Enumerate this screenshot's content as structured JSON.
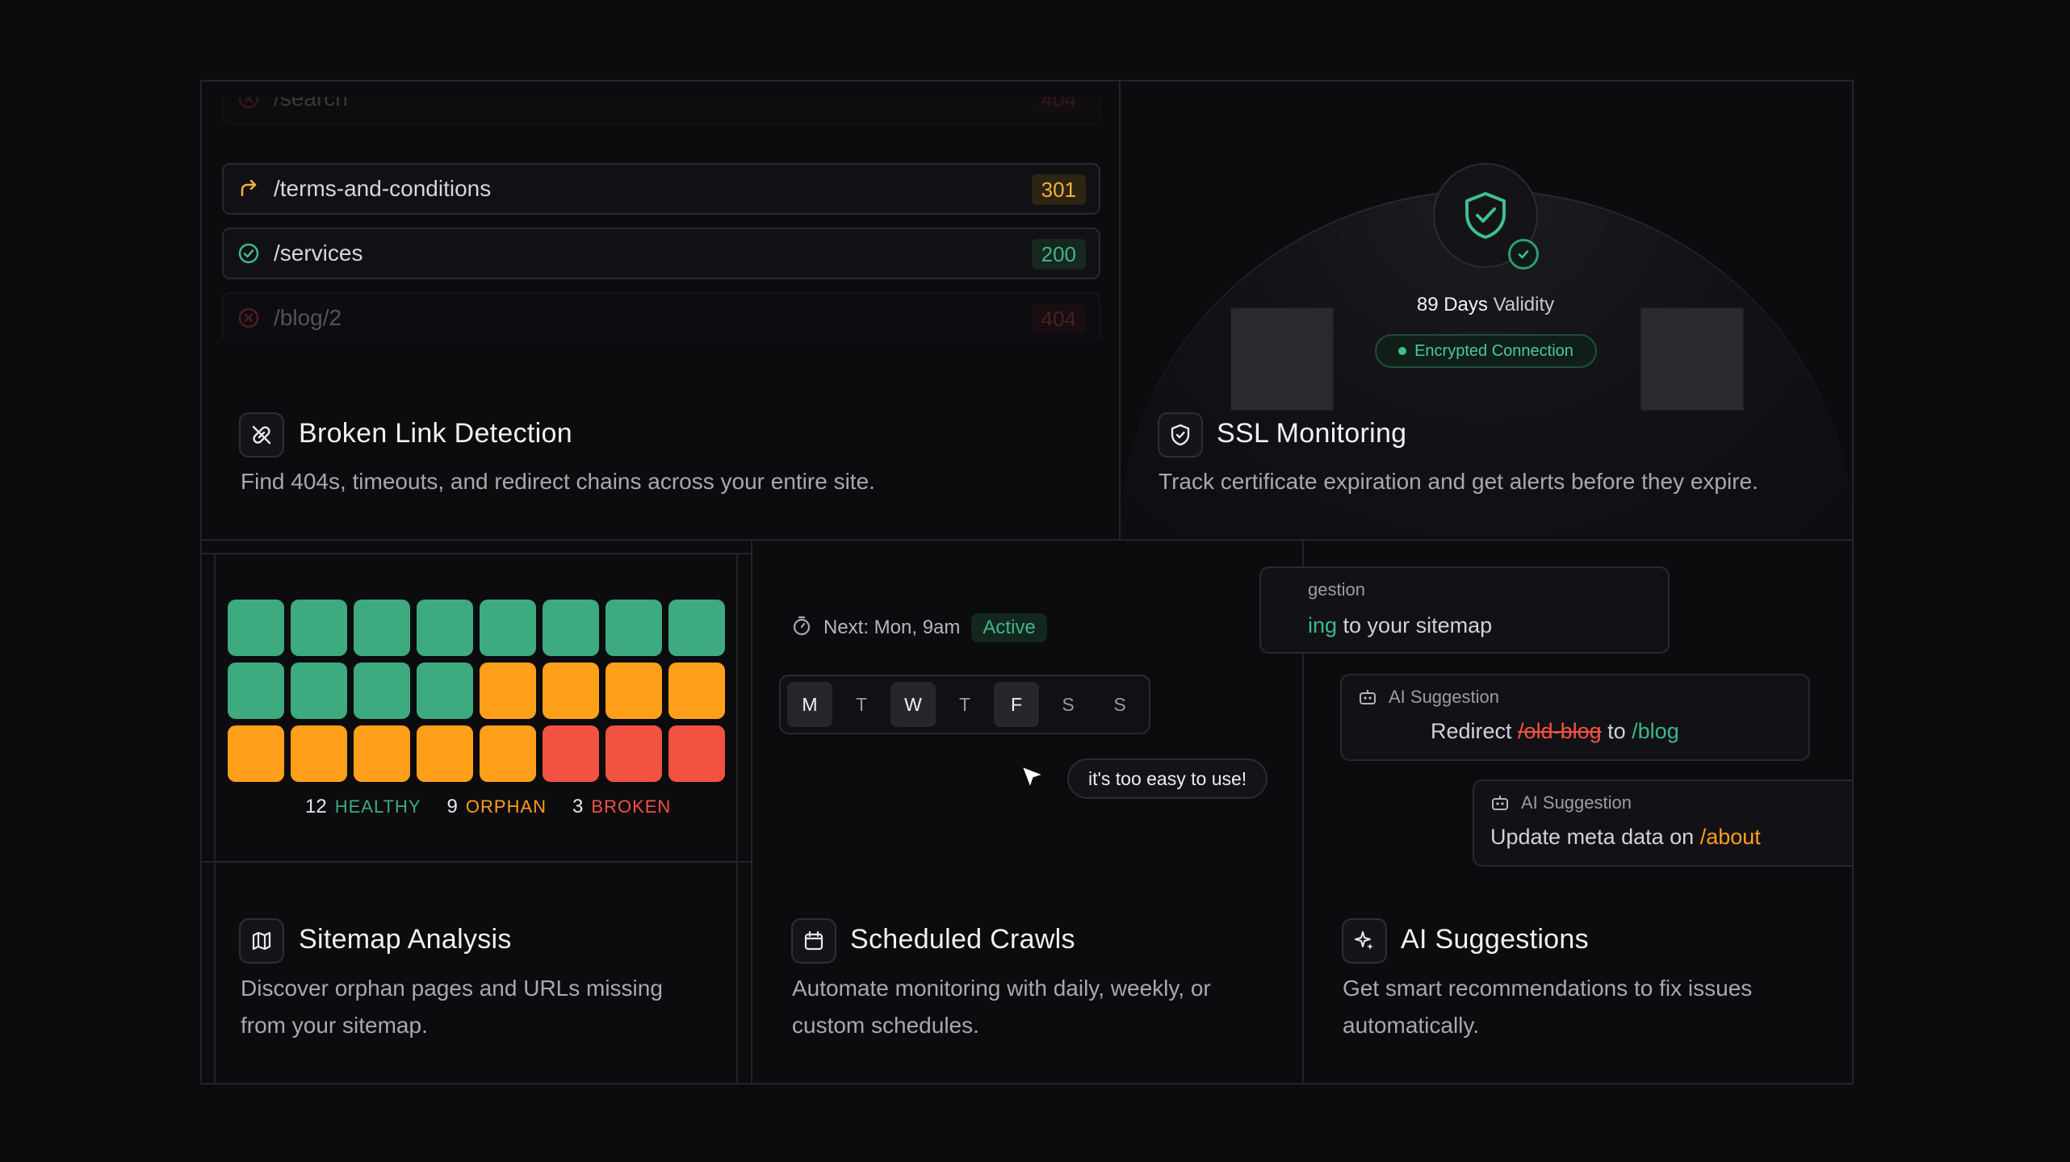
{
  "broken_links": {
    "rows": [
      {
        "path": "/search",
        "code": "404",
        "status": "error"
      },
      {
        "path": "/terms-and-conditions",
        "code": "301",
        "status": "redirect"
      },
      {
        "path": "/services",
        "code": "200",
        "status": "ok"
      },
      {
        "path": "/blog/2",
        "code": "404",
        "status": "error"
      }
    ],
    "title": "Broken Link Detection",
    "description": "Find 404s, timeouts, and redirect chains across your entire site."
  },
  "ssl": {
    "validity_days": "89 Days",
    "validity_label": "Validity",
    "encrypted_label": "Encrypted Connection",
    "title": "SSL Monitoring",
    "description": "Track certificate expiration and get alerts before they expire."
  },
  "sitemap": {
    "healthy_count": "12",
    "healthy_label": "HEALTHY",
    "orphan_count": "9",
    "orphan_label": "ORPHAN",
    "broken_count": "3",
    "broken_label": "BROKEN",
    "title": "Sitemap Analysis",
    "description_line1": "Discover orphan pages and URLs missing",
    "description_line2": "from your sitemap."
  },
  "scheduled": {
    "next_label": "Next: Mon, 9am",
    "status": "Active",
    "days": [
      "M",
      "T",
      "W",
      "T",
      "F",
      "S",
      "S"
    ],
    "tooltip": "it's too easy to use!",
    "title": "Scheduled Crawls",
    "description_line1": "Automate monitoring with daily, weekly, or",
    "description_line2": "custom schedules."
  },
  "ai": {
    "card1_label": "gestion",
    "card1_text_green": "ing",
    "card1_text_rest": " to your sitemap",
    "card2_label": "AI Suggestion",
    "card2_prefix": "Redirect ",
    "card2_old": "/old-blog",
    "card2_mid": " to ",
    "card2_new": "/blog",
    "card3_label": "AI Suggestion",
    "card3_prefix": "Update meta data on ",
    "card3_target": "/about",
    "title": "AI Suggestions",
    "description_line1": "Get smart recommendations to fix issues",
    "description_line2": "automatically."
  },
  "colors": {
    "healthy": "#3daa80",
    "orphan": "#ff9f1a",
    "broken": "#f25242"
  }
}
